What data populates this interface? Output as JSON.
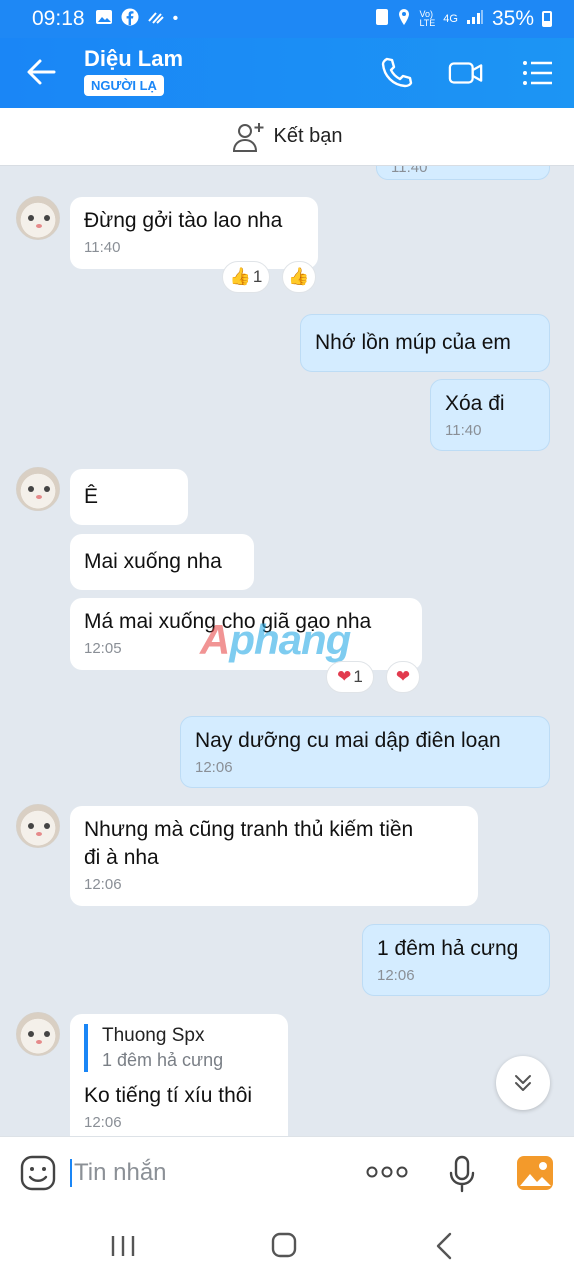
{
  "status": {
    "time": "09:18",
    "net1": "Vo)",
    "net2": "LTE",
    "net3": "4G",
    "battery": "35%"
  },
  "header": {
    "name": "Diệu Lam",
    "badge": "NGƯỜI LẠ"
  },
  "addfriend": {
    "label": "Kết bạn"
  },
  "watermark": {
    "a": "A",
    "rest": "phang"
  },
  "messages": {
    "prev_time": "11:40",
    "m1": {
      "text": "Đừng gởi tào lao nha",
      "time": "11:40",
      "react_count": "1"
    },
    "m2": {
      "text": "Nhớ lồn múp của em"
    },
    "m3": {
      "text": "Xóa đi",
      "time": "11:40"
    },
    "m4": {
      "text": "Ê"
    },
    "m5": {
      "text": "Mai xuống nha"
    },
    "m6": {
      "text": "Má mai xuống cho giã gạo nha",
      "time": "12:05",
      "react_count": "1"
    },
    "m7": {
      "text": "Nay dưỡng cu mai dập điên loạn",
      "time": "12:06"
    },
    "m8": {
      "line1": "Nhưng mà cũng tranh thủ kiếm tiền",
      "line2": "đi à nha",
      "time": "12:06"
    },
    "m9": {
      "text": "1 đêm hả cưng",
      "time": "12:06"
    },
    "m10": {
      "quote_name": "Thuong Spx",
      "quote_text": "1 đêm hả cưng",
      "text": "Ko tiếng tí xíu thôi",
      "time": "12:06"
    }
  },
  "input": {
    "placeholder": "Tin nhắn"
  },
  "colors": {
    "accent": "#1a86f6",
    "my_bubble": "#d4ecff",
    "background": "#e2e8ef"
  }
}
